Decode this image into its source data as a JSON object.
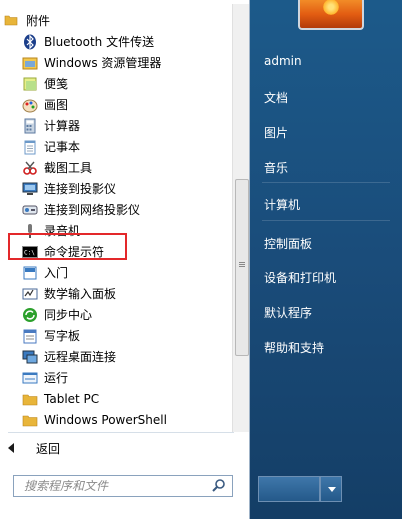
{
  "folder": {
    "label": "附件",
    "icon": "folder-icon"
  },
  "programs": [
    {
      "label": "Bluetooth 文件传送",
      "icon": "bluetooth-icon",
      "color": "#1b3e8a"
    },
    {
      "label": "Windows 资源管理器",
      "icon": "explorer-icon",
      "color": "#d9a43a"
    },
    {
      "label": "便笺",
      "icon": "sticky-notes-icon",
      "color": "#c7d95a"
    },
    {
      "label": "画图",
      "icon": "paint-icon",
      "color": "#e07a2a"
    },
    {
      "label": "计算器",
      "icon": "calculator-icon",
      "color": "#5c7aa0"
    },
    {
      "label": "记事本",
      "icon": "notepad-icon",
      "color": "#6d9ac9"
    },
    {
      "label": "截图工具",
      "icon": "snipping-tool-icon",
      "color": "#d02020"
    },
    {
      "label": "连接到投影仪",
      "icon": "projector-icon",
      "color": "#3a7ac0"
    },
    {
      "label": "连接到网络投影仪",
      "icon": "network-projector-icon",
      "color": "#3a7ac0"
    },
    {
      "label": "录音机",
      "icon": "sound-recorder-icon",
      "color": "#888888"
    },
    {
      "label": "命令提示符",
      "icon": "cmd-icon",
      "color": "#000000"
    },
    {
      "label": "入门",
      "icon": "getting-started-icon",
      "color": "#3a7ac0"
    },
    {
      "label": "数学输入面板",
      "icon": "math-input-icon",
      "color": "#4a6a9a"
    },
    {
      "label": "同步中心",
      "icon": "sync-center-icon",
      "color": "#2ca02c"
    },
    {
      "label": "写字板",
      "icon": "wordpad-icon",
      "color": "#4a7ac0"
    },
    {
      "label": "远程桌面连接",
      "icon": "remote-desktop-icon",
      "color": "#3a7ac0"
    },
    {
      "label": "运行",
      "icon": "run-icon",
      "color": "#3a7ac0"
    },
    {
      "label": "Tablet PC",
      "icon": "folder-icon",
      "color": "#e8b53a"
    },
    {
      "label": "Windows PowerShell",
      "icon": "folder-icon",
      "color": "#e8b53a"
    }
  ],
  "back": {
    "label": "返回",
    "icon": "back-arrow-icon"
  },
  "search": {
    "placeholder": "搜索程序和文件",
    "icon": "search-icon"
  },
  "right_menu": [
    {
      "label": "admin"
    },
    {
      "label": "文档"
    },
    {
      "label": "图片"
    },
    {
      "label": "音乐"
    },
    {
      "label": "计算机"
    },
    {
      "label": "控制面板"
    },
    {
      "label": "设备和打印机"
    },
    {
      "label": "默认程序"
    },
    {
      "label": "帮助和支持"
    }
  ],
  "highlight_color": "#e3282a",
  "accent": "#1a4c7a"
}
